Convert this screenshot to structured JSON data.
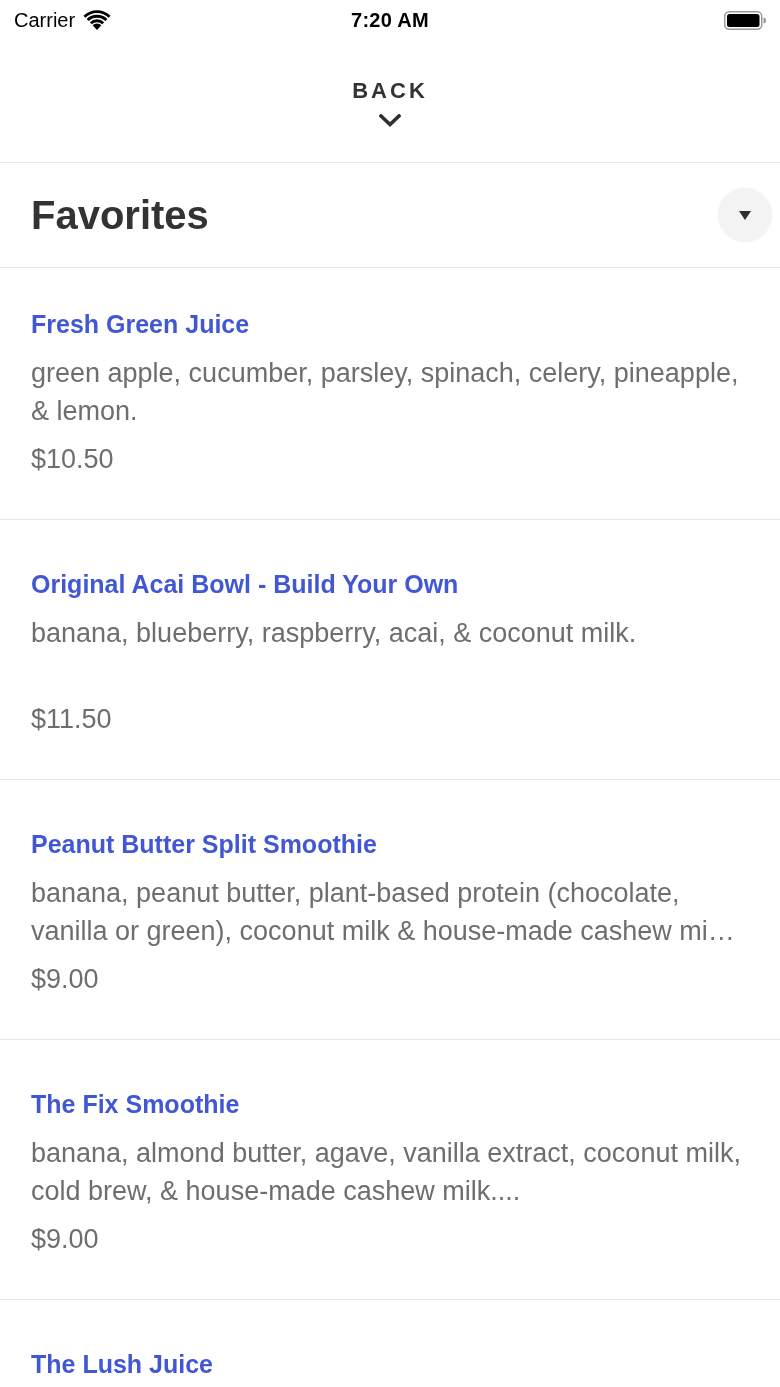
{
  "status_bar": {
    "carrier": "Carrier",
    "time": "7:20 AM"
  },
  "nav": {
    "back_label": "BACK"
  },
  "section": {
    "title": "Favorites"
  },
  "items": [
    {
      "name": "Fresh Green Juice",
      "description": "green apple, cucumber, parsley, spinach, celery, pineapple, & lemon.",
      "price": "$10.50"
    },
    {
      "name": "Original Acai Bowl - Build Your Own",
      "description": "banana, blueberry, raspberry, acai, & coconut milk.",
      "price": "$11.50"
    },
    {
      "name": "Peanut Butter Split Smoothie",
      "description": "banana, peanut butter, plant-based protein (chocolate, vanilla or green), coconut milk & house-made cashew mi…",
      "price": "$9.00"
    },
    {
      "name": "The Fix Smoothie",
      "description": "banana, almond butter, agave, vanilla extract, coconut milk, cold brew, & house-made cashew milk....",
      "price": "$9.00"
    },
    {
      "name": "The Lush Juice"
    }
  ]
}
